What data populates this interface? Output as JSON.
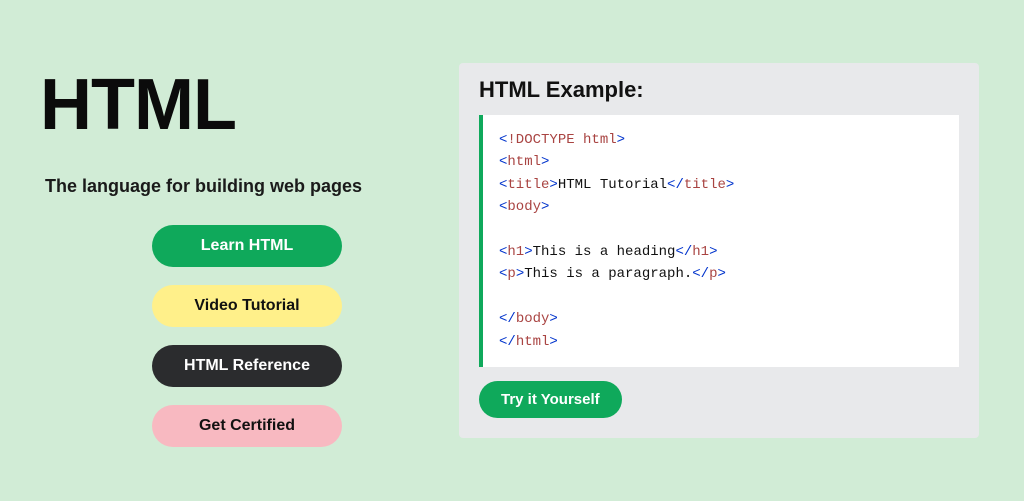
{
  "hero": {
    "title": "HTML",
    "subtitle": "The language for building web pages",
    "buttons": {
      "learn": "Learn HTML",
      "video": "Video Tutorial",
      "reference": "HTML Reference",
      "certified": "Get Certified"
    }
  },
  "example": {
    "heading": "HTML Example:",
    "try_label": "Try it Yourself",
    "code_tokens": [
      {
        "cls": "t-blue",
        "t": "<"
      },
      {
        "cls": "t-brown",
        "t": "!DOCTYPE"
      },
      {
        "cls": "t-brown",
        "t": " html"
      },
      {
        "cls": "t-blue",
        "t": ">"
      },
      {
        "cls": "nl",
        "t": "\n"
      },
      {
        "cls": "t-blue",
        "t": "<"
      },
      {
        "cls": "t-brown",
        "t": "html"
      },
      {
        "cls": "t-blue",
        "t": ">"
      },
      {
        "cls": "nl",
        "t": "\n"
      },
      {
        "cls": "t-blue",
        "t": "<"
      },
      {
        "cls": "t-brown",
        "t": "title"
      },
      {
        "cls": "t-blue",
        "t": ">"
      },
      {
        "cls": "t-text",
        "t": "HTML Tutorial"
      },
      {
        "cls": "t-blue",
        "t": "</"
      },
      {
        "cls": "t-brown",
        "t": "title"
      },
      {
        "cls": "t-blue",
        "t": ">"
      },
      {
        "cls": "nl",
        "t": "\n"
      },
      {
        "cls": "t-blue",
        "t": "<"
      },
      {
        "cls": "t-brown",
        "t": "body"
      },
      {
        "cls": "t-blue",
        "t": ">"
      },
      {
        "cls": "nl",
        "t": "\n"
      },
      {
        "cls": "nl",
        "t": "\n"
      },
      {
        "cls": "t-blue",
        "t": "<"
      },
      {
        "cls": "t-brown",
        "t": "h1"
      },
      {
        "cls": "t-blue",
        "t": ">"
      },
      {
        "cls": "t-text",
        "t": "This is a heading"
      },
      {
        "cls": "t-blue",
        "t": "</"
      },
      {
        "cls": "t-brown",
        "t": "h1"
      },
      {
        "cls": "t-blue",
        "t": ">"
      },
      {
        "cls": "nl",
        "t": "\n"
      },
      {
        "cls": "t-blue",
        "t": "<"
      },
      {
        "cls": "t-brown",
        "t": "p"
      },
      {
        "cls": "t-blue",
        "t": ">"
      },
      {
        "cls": "t-text",
        "t": "This is a paragraph."
      },
      {
        "cls": "t-blue",
        "t": "</"
      },
      {
        "cls": "t-brown",
        "t": "p"
      },
      {
        "cls": "t-blue",
        "t": ">"
      },
      {
        "cls": "nl",
        "t": "\n"
      },
      {
        "cls": "nl",
        "t": "\n"
      },
      {
        "cls": "t-blue",
        "t": "</"
      },
      {
        "cls": "t-brown",
        "t": "body"
      },
      {
        "cls": "t-blue",
        "t": ">"
      },
      {
        "cls": "nl",
        "t": "\n"
      },
      {
        "cls": "t-blue",
        "t": "</"
      },
      {
        "cls": "t-brown",
        "t": "html"
      },
      {
        "cls": "t-blue",
        "t": ">"
      }
    ]
  }
}
